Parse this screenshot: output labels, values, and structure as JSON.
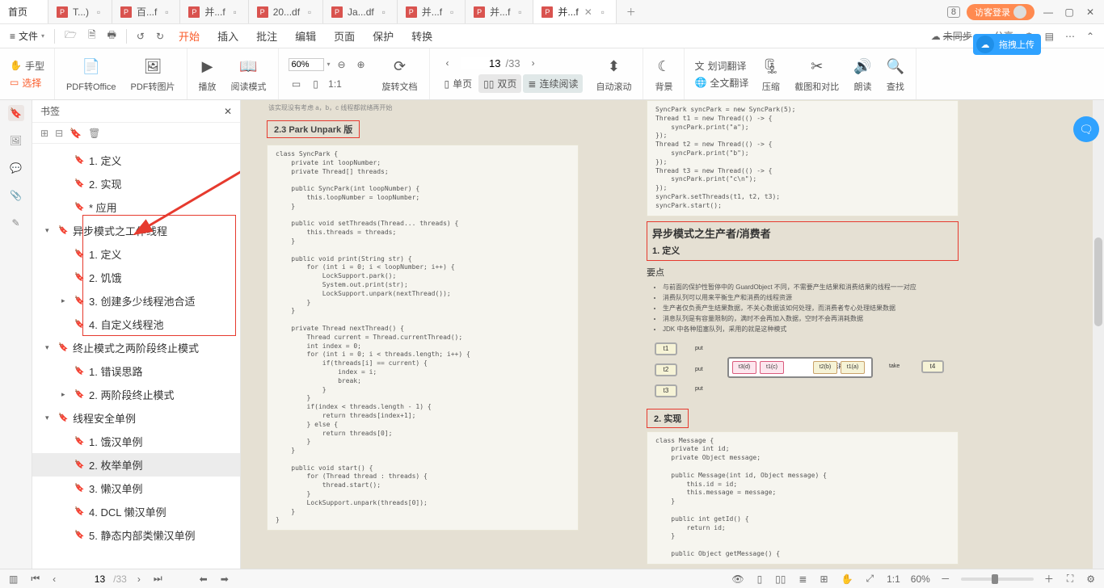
{
  "tabs": {
    "home": "首页",
    "items": [
      {
        "label": "T...)"
      },
      {
        "label": "百...f"
      },
      {
        "label": "并...f"
      },
      {
        "label": "20...df"
      },
      {
        "label": "Ja...df"
      },
      {
        "label": "并...f"
      },
      {
        "label": "并...f"
      },
      {
        "label": "并...f"
      }
    ],
    "active_index": 7,
    "badge_count": "8",
    "login": "访客登录"
  },
  "menubar": {
    "file": "文件",
    "start": "开始",
    "insert": "插入",
    "annotate": "批注",
    "edit": "编辑",
    "page": "页面",
    "protect": "保护",
    "convert": "转换",
    "unsync": "未同步",
    "share": "分享"
  },
  "toolbar": {
    "hand": "手型",
    "select": "选择",
    "pdf_office": "PDF转Office",
    "pdf_image": "PDF转图片",
    "play": "播放",
    "read_mode": "阅读模式",
    "zoom_value": "60%",
    "rotate": "旋转文档",
    "single": "单页",
    "double": "双页",
    "continuous": "连续阅读",
    "autoscroll": "自动滚动",
    "background": "背景",
    "word_trans": "划词翻译",
    "full_trans": "全文翻译",
    "compress": "压缩",
    "crop": "截图和对比",
    "read_aloud": "朗读",
    "find": "查找",
    "page_current": "13",
    "page_total": "33"
  },
  "cloud_badge": {
    "label": "拖拽上传"
  },
  "sidebar": {
    "title": "书签",
    "tree": [
      {
        "level": 1,
        "label": "1. 定义"
      },
      {
        "level": 1,
        "label": "2. 实现"
      },
      {
        "level": 1,
        "label": "* 应用"
      },
      {
        "level": 0,
        "label": "异步模式之工作线程",
        "expanded": true
      },
      {
        "level": 1,
        "label": "1. 定义"
      },
      {
        "level": 1,
        "label": "2. 饥饿"
      },
      {
        "level": 1,
        "label": "3. 创建多少线程池合适",
        "expandable": true
      },
      {
        "level": 1,
        "label": "4. 自定义线程池"
      },
      {
        "level": 0,
        "label": "终止模式之两阶段终止模式",
        "expanded": true
      },
      {
        "level": 1,
        "label": "1. 错误思路"
      },
      {
        "level": 1,
        "label": "2. 两阶段终止模式",
        "expandable": true
      },
      {
        "level": 0,
        "label": "线程安全单例",
        "expanded": true
      },
      {
        "level": 1,
        "label": "1. 饿汉单例"
      },
      {
        "level": 1,
        "label": "2. 枚举单例",
        "selected": true
      },
      {
        "level": 1,
        "label": "3. 懒汉单例"
      },
      {
        "level": 1,
        "label": "4. DCL 懒汉单例"
      },
      {
        "level": 1,
        "label": "5. 静态内部类懒汉单例"
      }
    ]
  },
  "doc": {
    "note": "该实现没有考虑 a，b，c 线程都就绪再开始",
    "section_left": "2.3 Park Unpark 版",
    "code_left": "class SyncPark {\n    private int loopNumber;\n    private Thread[] threads;\n\n    public SyncPark(int loopNumber) {\n        this.loopNumber = loopNumber;\n    }\n\n    public void setThreads(Thread... threads) {\n        this.threads = threads;\n    }\n\n    public void print(String str) {\n        for (int i = 0; i < loopNumber; i++) {\n            LockSupport.park();\n            System.out.print(str);\n            LockSupport.unpark(nextThread());\n        }\n    }\n\n    private Thread nextThread() {\n        Thread current = Thread.currentThread();\n        int index = 0;\n        for (int i = 0; i < threads.length; i++) {\n            if(threads[i] == current) {\n                index = i;\n                break;\n            }\n        }\n        if(index < threads.length - 1) {\n            return threads[index+1];\n        } else {\n            return threads[0];\n        }\n    }\n\n    public void start() {\n        for (Thread thread : threads) {\n            thread.start();\n        }\n        LockSupport.unpark(threads[0]);\n    }\n}",
    "code_r1": "SyncPark syncPark = new SyncPark(5);\nThread t1 = new Thread(() -> {\n    syncPark.print(\"a\");\n});\nThread t2 = new Thread(() -> {\n    syncPark.print(\"b\");\n});\nThread t3 = new Thread(() -> {\n    syncPark.print(\"c\\n\");\n});\nsyncPark.setThreads(t1, t2, t3);\nsyncPark.start();",
    "h_producer": "异步模式之生产者/消费者",
    "h_def": "1. 定义",
    "points_label": "要点",
    "points": [
      "与前面的保护性暂停中的 GuardObject 不同，不需要产生结果和消费结果的线程一一对应",
      "消费队列可以用来平衡生产和消费的线程资源",
      "生产者仅负责产生结果数据，不关心数据该如何处理，而消费者专心处理结果数据",
      "消息队列是有容量限制的，满时不会再加入数据，空时不会再消耗数据",
      "JDK 中各种阻塞队列，采用的就是这种模式"
    ],
    "diag": {
      "t1": "t1",
      "t2": "t2",
      "t3": "t3",
      "t4": "t4",
      "put": "put",
      "take": "take",
      "queue": "消息队列",
      "s1": "t3(d)",
      "s2": "t1(c)",
      "s3": "t2(b)",
      "s4": "t1(a)"
    },
    "h_impl": "2. 实现",
    "code_r2": "class Message {\n    private int id;\n    private Object message;\n\n    public Message(int id, Object message) {\n        this.id = id;\n        this.message = message;\n    }\n\n    public int getId() {\n        return id;\n    }\n\n    public Object getMessage() {"
  },
  "statusbar": {
    "page_current": "13",
    "page_total": "33",
    "zoom": "60%"
  }
}
